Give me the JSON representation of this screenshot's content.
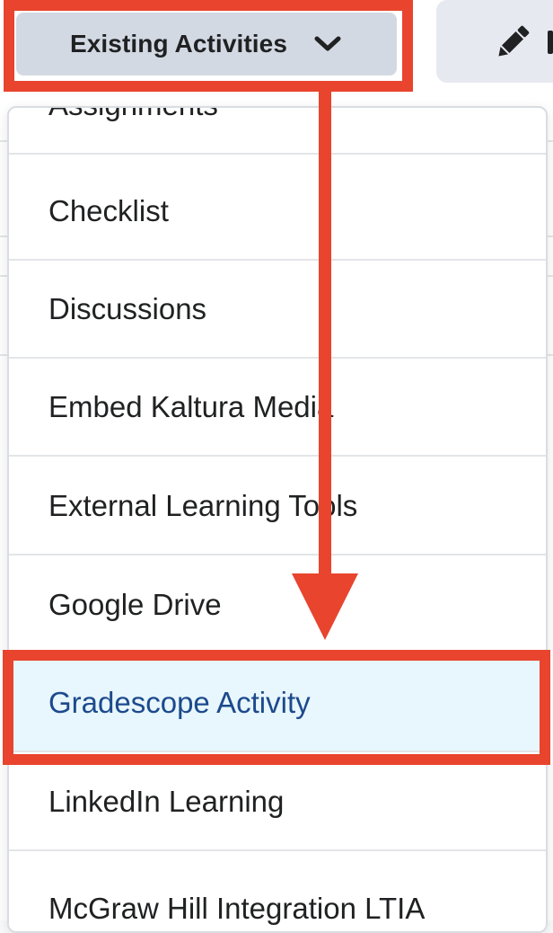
{
  "toolbar": {
    "existing_activities_label": "Existing Activities",
    "chevron_icon": "chevron-down-icon",
    "edit_icon": "pencil-icon"
  },
  "dropdown": {
    "items": [
      {
        "label": "Assignments",
        "selected": false
      },
      {
        "label": "Checklist",
        "selected": false
      },
      {
        "label": "Discussions",
        "selected": false
      },
      {
        "label": "Embed Kaltura Media",
        "selected": false
      },
      {
        "label": "External Learning Tools",
        "selected": false
      },
      {
        "label": "Google Drive",
        "selected": false
      },
      {
        "label": "Gradescope Activity",
        "selected": true
      },
      {
        "label": "LinkedIn Learning",
        "selected": false
      },
      {
        "label": "McGraw Hill Integration LTIA",
        "selected": false
      }
    ]
  },
  "colors": {
    "annotation_red": "#e8442e",
    "selected_bg": "#e8f6fd",
    "selected_text": "#1c4a8c",
    "button_bg": "#d3d9e3"
  }
}
